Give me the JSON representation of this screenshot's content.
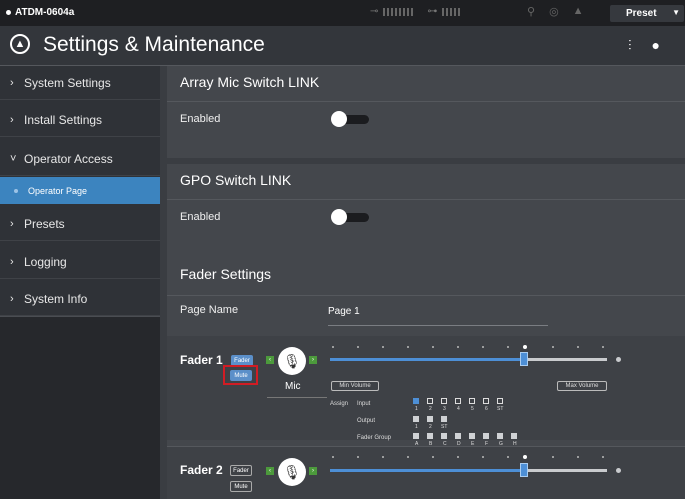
{
  "topbar": {
    "device_name": "ATDM-0604a",
    "preset_label": "Preset"
  },
  "header": {
    "title": "Settings & Maintenance"
  },
  "sidebar": {
    "items": [
      {
        "label": "System Settings"
      },
      {
        "label": "Install Settings"
      },
      {
        "label": "Operator Access"
      },
      {
        "label": "Presets"
      },
      {
        "label": "Logging"
      },
      {
        "label": "System Info"
      }
    ],
    "sub_item": "Operator Page"
  },
  "array_mic": {
    "title": "Array Mic Switch LINK",
    "enabled_label": "Enabled"
  },
  "gpo": {
    "title": "GPO Switch LINK",
    "enabled_label": "Enabled"
  },
  "fader_settings": {
    "title": "Fader Settings",
    "page_name_label": "Page Name",
    "page_name_value": "Page 1",
    "fader1": {
      "name": "Fader 1",
      "fader_btn": "Fader",
      "mute_btn": "Mute",
      "mic_label": "Mic",
      "min_volume": "Min Volume",
      "max_volume": "Max Volume",
      "assign_label": "Assign",
      "input_label": "Input",
      "output_label": "Output",
      "fader_group_label": "Fader Group",
      "input_nums": [
        "1",
        "2",
        "3",
        "4",
        "5",
        "6",
        "ST"
      ],
      "output_nums": [
        "1",
        "2",
        "ST"
      ],
      "group_letters": [
        "A",
        "B",
        "C",
        "D",
        "E",
        "F",
        "G",
        "H"
      ]
    },
    "fader2": {
      "name": "Fader 2",
      "fader_btn": "Fader",
      "mute_btn": "Mute"
    }
  },
  "colors": {
    "accent": "#3c84bf",
    "highlight": "#d11c24"
  }
}
